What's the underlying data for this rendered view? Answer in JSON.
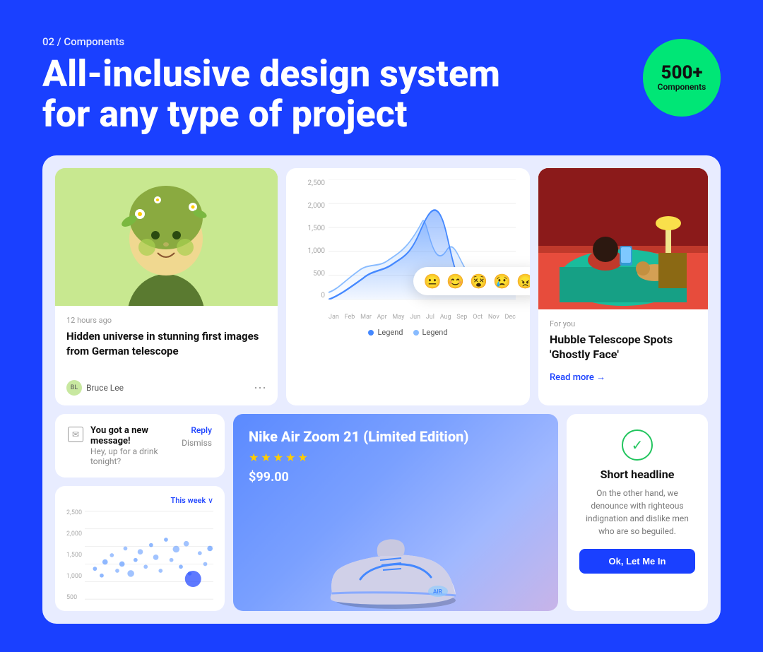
{
  "header": {
    "subtitle": "02 / Components",
    "title": "All-inclusive design system for any type of project",
    "badge_number": "500+",
    "badge_label": "Components"
  },
  "article_card": {
    "timestamp": "12 hours ago",
    "title": "Hidden universe in stunning first images from German telescope",
    "author": "Bruce Lee"
  },
  "chart_card": {
    "y_labels": [
      "2,500",
      "2,000",
      "1,500",
      "1,000",
      "500",
      "0"
    ],
    "x_labels": [
      "Jan",
      "Feb",
      "Mar",
      "Apr",
      "May",
      "Jun",
      "Jul",
      "Aug",
      "Sep",
      "Oct",
      "Nov",
      "Dec"
    ],
    "legend_1": "Legend",
    "legend_2": "Legend"
  },
  "emoji_bar": {
    "emojis": [
      "😐",
      "😊",
      "😵",
      "😢",
      "😠"
    ]
  },
  "news_card": {
    "for_you": "For you",
    "title": "Hubble Telescope Spots 'Ghostly Face'",
    "read_more": "Read more →"
  },
  "message_card": {
    "icon": "✉",
    "title": "You got a new message!",
    "body": "Hey, up for a drink tonight?",
    "reply": "Reply",
    "dismiss": "Dismiss"
  },
  "scatter_card": {
    "this_week": "This week ∨",
    "y_labels": [
      "2,500",
      "2,000",
      "1,500",
      "1,000",
      "500"
    ]
  },
  "product_card": {
    "title": "Nike Air Zoom 21 (Limited Edition)",
    "stars": 5,
    "price": "$99.00"
  },
  "cta_card": {
    "title": "Short headline",
    "body": "On the other hand, we denounce with righteous indignation and dislike men who are so beguiled.",
    "button": "Ok, Let Me In"
  }
}
